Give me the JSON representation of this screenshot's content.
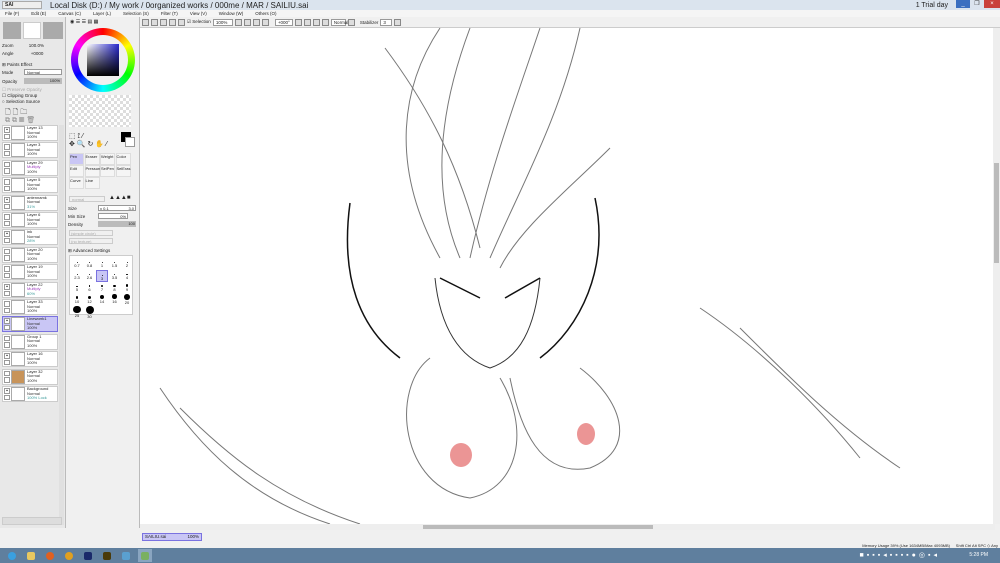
{
  "window": {
    "app_logo": "PaintTool SAI",
    "path": "Local Disk (D:) / My work / 0organized works / 000me / MAR / SAILIU.sai",
    "trial": "1 Trial day",
    "min": "_",
    "max": "❐",
    "close": "×"
  },
  "menu": [
    "File (F)",
    "Edit (E)",
    "Canvas (C)",
    "Layer (L)",
    "Selection (S)",
    "Filter (T)",
    "View (V)",
    "Window (W)",
    "Others (O)"
  ],
  "toolbar": {
    "selection_label": "Selection",
    "zoom": "100%",
    "angle": "+000°",
    "mode": "Normal",
    "stabilizer_label": "Stabilizer",
    "stabilizer": "3"
  },
  "navigator": {
    "zoom_label": "Zoom",
    "zoom": "100.0%",
    "angle_label": "Angle",
    "angle": "+0000"
  },
  "layer_panel": {
    "paints_effect": "Paints Effect",
    "mode_label": "Mode",
    "mode": "Normal",
    "opacity_label": "Opacity",
    "opacity": "100%",
    "preserve_opacity": "Preserve Opacity",
    "clipping_group": "Clipping Group",
    "selection_source": "Selection Source"
  },
  "layers": [
    {
      "name": "Layer 13",
      "mode": "Normal",
      "opacity": "100%",
      "visible": true
    },
    {
      "name": "Layer 3",
      "mode": "Normal",
      "opacity": "100%",
      "visible": false
    },
    {
      "name": "Layer 29",
      "mode": "Multiply",
      "opacity": "100%",
      "visible": false
    },
    {
      "name": "Layer 5",
      "mode": "Normal",
      "opacity": "100%",
      "visible": false
    },
    {
      "name": "antennamk",
      "mode": "Normal",
      "opacity": "31%",
      "visible": true
    },
    {
      "name": "Layer 6",
      "mode": "Normal",
      "opacity": "100%",
      "visible": false
    },
    {
      "name": "ink",
      "mode": "Normal",
      "opacity": "28%",
      "visible": true
    },
    {
      "name": "Layer 20",
      "mode": "Normal",
      "opacity": "100%",
      "visible": false
    },
    {
      "name": "Layer 19",
      "mode": "Normal",
      "opacity": "100%",
      "visible": false
    },
    {
      "name": "Layer 22",
      "mode": "Multiply",
      "opacity": "60%",
      "visible": true
    },
    {
      "name": "Layer 33",
      "mode": "Normal",
      "opacity": "100%",
      "visible": false
    },
    {
      "name": "Lineworrk1",
      "mode": "Normal",
      "opacity": "100%",
      "visible": true
    },
    {
      "name": "Group 1",
      "mode": "Normal",
      "opacity": "100%",
      "visible": false
    },
    {
      "name": "Layer 16",
      "mode": "Normal",
      "opacity": "100%",
      "visible": true
    },
    {
      "name": "Layer 32",
      "mode": "Normal",
      "opacity": "100%",
      "visible": false
    },
    {
      "name": "Background",
      "mode": "Normal",
      "opacity": "100% Lock",
      "visible": true
    }
  ],
  "tools": {
    "brush_tools": [
      "Pen",
      "Eraser",
      "Weight",
      "Color",
      "Edit",
      "Pressure",
      "SelPen",
      "SelEras",
      "Curve",
      "Line"
    ],
    "blend": "normal",
    "size_label": "Size",
    "size_mult": "x 0.1",
    "size": "3.0",
    "minsize_label": "Min Size",
    "minsize": "0%",
    "density_label": "Density",
    "density": "100",
    "shape": "(simple circle)",
    "texture": "(no texture)",
    "advanced": "Advanced Settings",
    "brush_sizes": [
      "0.7",
      "0.8",
      "1",
      "1.5",
      "2",
      "2.3",
      "2.6",
      "3",
      "3.5",
      "4",
      "5",
      "6",
      "7",
      "8",
      "9",
      "10",
      "12",
      "14",
      "16",
      "20",
      "25",
      "30"
    ]
  },
  "document_tab": {
    "name": "SAILIU.sai",
    "zoom": "100%"
  },
  "status": {
    "memory": "Memory Usage 39% (Use 1634MB/Max 4093MB)",
    "keys": "Shift Ctrl Alt SPC ◇ Any"
  },
  "taskbar": {
    "clock": "5:28 PM"
  }
}
